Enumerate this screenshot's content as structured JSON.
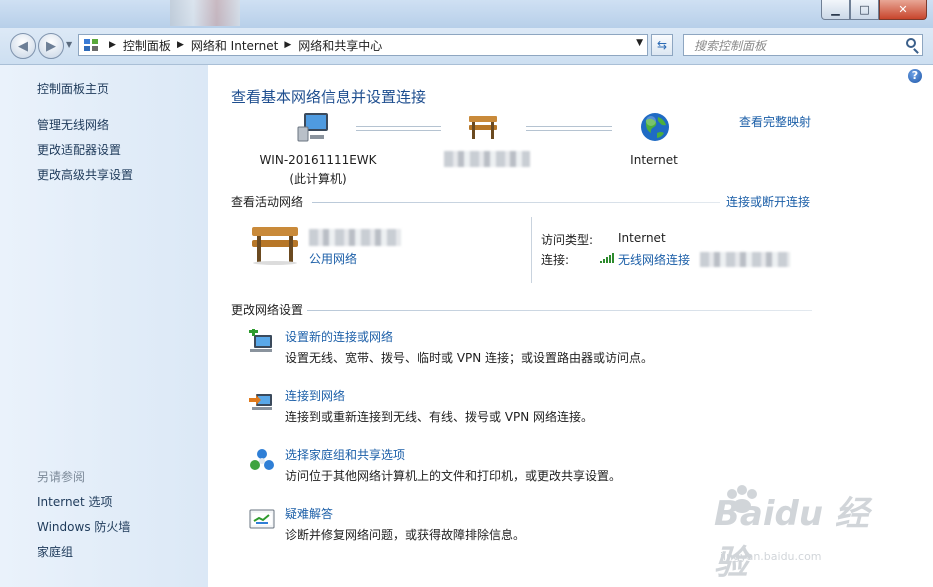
{
  "window": {
    "controls": {
      "minimize": "▁",
      "maximize": "□",
      "close": "✕"
    }
  },
  "navbar": {
    "breadcrumbs": [
      {
        "label": "控制面板"
      },
      {
        "label": "网络和 Internet"
      },
      {
        "label": "网络和共享中心"
      }
    ],
    "search": {
      "placeholder": "搜索控制面板"
    }
  },
  "sidebar": {
    "home": "控制面板主页",
    "links": [
      "管理无线网络",
      "更改适配器设置",
      "更改高级共享设置"
    ],
    "see_also_heading": "另请参阅",
    "see_also": [
      "Internet 选项",
      "Windows 防火墙",
      "家庭组"
    ]
  },
  "main": {
    "title": "查看基本网络信息并设置连接",
    "full_map_link": "查看完整映射",
    "map": {
      "computer_name": "WIN-20161111EWK",
      "computer_sub": "(此计算机)",
      "internet_label": "Internet"
    },
    "active_section": {
      "heading": "查看活动网络",
      "connect_link": "连接或断开连接",
      "network_type": "公用网络",
      "access_type_label": "访问类型:",
      "access_type_value": "Internet",
      "connections_label": "连接:",
      "connection_value": "无线网络连接"
    },
    "change_section": {
      "heading": "更改网络设置",
      "tasks": [
        {
          "title": "设置新的连接或网络",
          "desc": "设置无线、宽带、拨号、临时或 VPN 连接；或设置路由器或访问点。",
          "icon": "new-connection-icon"
        },
        {
          "title": "连接到网络",
          "desc": "连接到或重新连接到无线、有线、拨号或 VPN 网络连接。",
          "icon": "connect-network-icon"
        },
        {
          "title": "选择家庭组和共享选项",
          "desc": "访问位于其他网络计算机上的文件和打印机，或更改共享设置。",
          "icon": "homegroup-icon"
        },
        {
          "title": "疑难解答",
          "desc": "诊断并修复网络问题，或获得故障排除信息。",
          "icon": "troubleshoot-icon"
        }
      ]
    }
  },
  "watermark": {
    "brand": "Baidu 经验",
    "url": "jingyan.baidu.com"
  }
}
